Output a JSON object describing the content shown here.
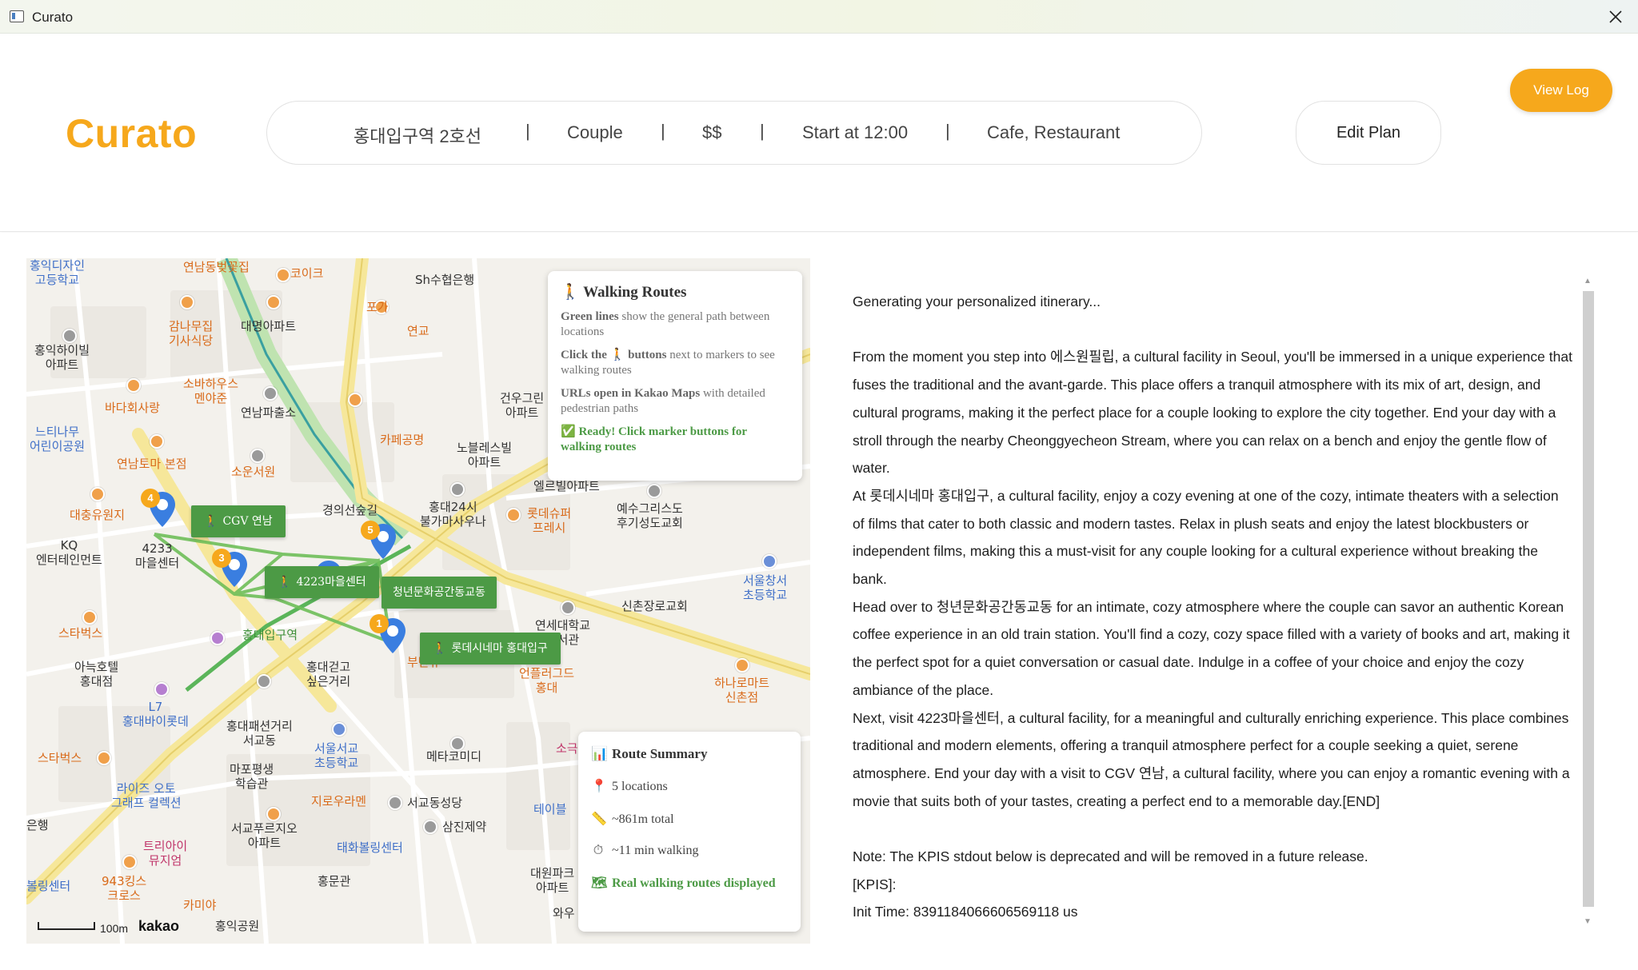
{
  "window": {
    "title": "Curato",
    "icon": "app-window-icon",
    "close_icon": "close-icon"
  },
  "header": {
    "logo": "Curato",
    "plan": {
      "station": "홍대입구역 2호선",
      "companion": "Couple",
      "budget": "$$",
      "start": "Start at 12:00",
      "categories": "Cafe, Restaurant",
      "separator": "|"
    },
    "edit_plan": "Edit Plan",
    "view_log": "View Log"
  },
  "map": {
    "info_box": {
      "title": "Walking Routes",
      "green_lines_bold": "Green lines",
      "green_lines_text": "show the general path between locations",
      "click_the": "Click the",
      "buttons_bold": "buttons",
      "buttons_text": "next to markers to see walking routes",
      "urls_bold": "URLs open in Kakao Maps",
      "urls_text": "with detailed pedestrian paths",
      "ready": "Ready! Click marker buttons for walking routes"
    },
    "route_buttons": [
      "CGV 연남",
      "4223마을센터",
      "청년문화공간동교동",
      "롯데시네마 홍대입구"
    ],
    "markers": [
      "4",
      "3",
      "5",
      "1",
      "2"
    ],
    "summary": {
      "title": "Route Summary",
      "locations": "5 locations",
      "distance": "~861m total",
      "time": "~11 min walking",
      "status": "Real walking routes displayed"
    },
    "scale": "100m",
    "provider": "kakao",
    "labels": {
      "l1": "홍익디자인\n고등학교",
      "l2": "연남동벚꽃집",
      "l3": "코이크",
      "l4": "Sh수협은행",
      "l5": "감나무집\n기사식당",
      "l6": "대명아파트",
      "l7": "포가",
      "l8": "연교",
      "l9": "홍익하이빌\n아파트",
      "l10": "소바하우스\n멘야준",
      "l11": "바다회사랑",
      "l12": "연남파출소",
      "l13": "느티나무\n어린이공원",
      "l14": "연남토마 본점",
      "l15": "소운서원",
      "l16": "카페공명",
      "l17": "노블레스빌\n아파트",
      "l18": "건우그린\n아파트",
      "l19": "엘르빌아파트",
      "l20": "홍대24시\n불가마사우나",
      "l21": "롯데슈퍼\n프레시",
      "l22": "예수그리스도\n후기성도교회",
      "l23": "대충유원지",
      "l24": "KQ\n엔터테인먼트",
      "l25": "4233\n마을센터",
      "l26": "경의선숲길",
      "l27": "서울창서\n초등학교",
      "l28": "신촌장로교회",
      "l29": "스타벅스",
      "l30": "연세대학교\n도서관",
      "l31": "아늑호텔\n홍대점",
      "l32": "홍대입구역",
      "l33": "홍대걷고\n싶은거리",
      "l34": "언플러그드\n홍대",
      "l35": "하나로마트\n신촌점",
      "l36": "부탄츄",
      "l37": "L7\n홍대바이롯데",
      "l38": "홍대패션거리\n서교동",
      "l39": "서울서교\n초등학교",
      "l40": "메타코미디",
      "l41": "스타벅스",
      "l42": "마포평생\n학습관",
      "l43": "라이즈 오토\n그래프 컬렉션",
      "l44": "지로우라멘",
      "l45": "서교동성당",
      "l46": "삼진제약",
      "l47": "서교푸르지오\n아파트",
      "l48": "트리아이\n뮤지엄",
      "l49": "태화볼링센터",
      "l50": "943킹스\n크로스",
      "l51": "홍문관",
      "l52": "대원파크\n아파트",
      "l53": "카미야",
      "l54": "홍익공원",
      "l55": "와우",
      "l56": "테이블",
      "l57": "소극",
      "l58": "은행",
      "l59": "볼링센터"
    }
  },
  "itinerary": {
    "p1": "Generating your personalized itinerary...",
    "p2": " From the moment you step into 에스원필립, a cultural facility in Seoul, you'll be immersed in a unique experience that fuses the traditional and the avant-garde. This place offers a tranquil atmosphere with its mix of art, design, and cultural programs, making it the perfect place for a couple looking to explore the city together. End your day with a stroll through the nearby Cheonggyecheon Stream, where you can relax on a bench and enjoy the gentle flow of water.",
    "p3": "At 롯데시네마 홍대입구, a cultural facility, enjoy a cozy evening at one of the cozy, intimate theaters with a selection of films that cater to both classic and modern tastes. Relax in plush seats and enjoy the latest blockbusters or independent films, making this a must-visit for any couple looking for a cultural experience without breaking the bank.",
    "p4": "Head over to 청년문화공간동교동 for an intimate, cozy atmosphere where the couple can savor an authentic Korean coffee experience in an old train station. You'll find a cozy, cozy space filled with a variety of books and art, making it the perfect spot for a quiet conversation or casual date. Indulge in a coffee of your choice and enjoy the cozy ambiance of the place.",
    "p5": "Next, visit 4223마을센터, a cultural facility, for a meaningful and culturally enriching experience. This place combines traditional and modern elements, offering a tranquil atmosphere perfect for a couple seeking a quiet, serene atmosphere. End your day with a visit to CGV 연남, a cultural facility, where you can enjoy a romantic evening with a movie that suits both of your tastes, creating a perfect end to a memorable day.[END]",
    "p6": "Note: The KPIS stdout below is deprecated and will be removed in a future release.",
    "p7": "[KPIS]:",
    "p8": "Init Time: 8391184066606569118 us"
  },
  "colors": {
    "accent": "#f6a81c",
    "route_green": "#4c9a45",
    "marker_blue": "#3a7ee0"
  }
}
